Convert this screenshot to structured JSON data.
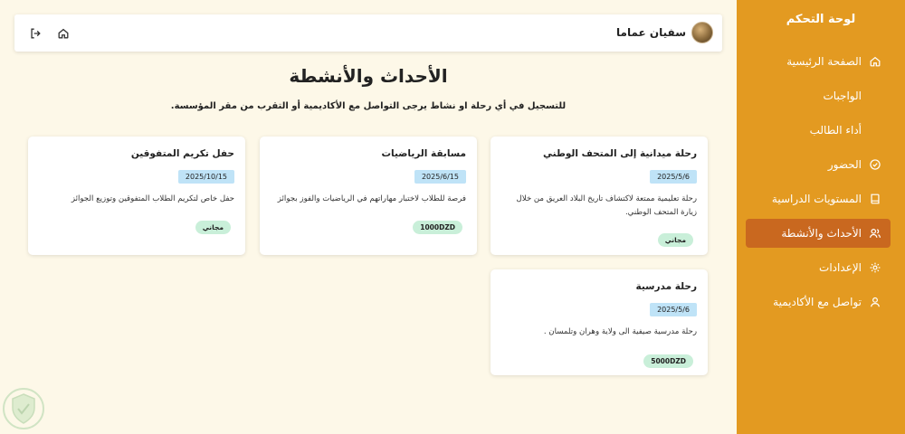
{
  "sidebar": {
    "title": "لوحة التحكم",
    "items": [
      {
        "label": "الصفحة الرئيسية",
        "icon": "home-icon"
      },
      {
        "label": "الواجبات",
        "icon": "assignment-icon"
      },
      {
        "label": "أداء الطالب",
        "icon": "chart-icon"
      },
      {
        "label": "الحضور",
        "icon": "check-circle-icon"
      },
      {
        "label": "المستويات الدراسية",
        "icon": "book-icon"
      },
      {
        "label": "الأحداث والأنشطة",
        "icon": "users-icon",
        "active": true
      },
      {
        "label": "الإعدادات",
        "icon": "gear-icon"
      },
      {
        "label": "تواصل مع الأكاديمية",
        "icon": "user-icon"
      }
    ]
  },
  "topbar": {
    "user_name": "سفيان عماما",
    "icons": [
      "logout-icon",
      "home-icon"
    ]
  },
  "page": {
    "title": "الأحداث والأنشطة",
    "subtitle": "للتسجيل في أي رحلة او نشاط يرجى التواصل مع الأكاديمية أو التقرب من مقر المؤسسة."
  },
  "events": [
    {
      "title": "رحلة ميدانية إلى المتحف الوطني",
      "date": "2025/5/6",
      "description": [
        "رحلة تعليمية ممتعة لاكتشاف تاريخ البلاد العريق من خلال",
        "زيارة المتحف الوطني."
      ],
      "price": "مجاني"
    },
    {
      "title": "مسابقة الرياضيات",
      "date": "2025/6/15",
      "description": [
        "فرصة للطلاب لاختبار مهاراتهم في الرياضيات والفوز بجوائز"
      ],
      "price": "1000DZD"
    },
    {
      "title": "حفل تكريم المتفوقين",
      "date": "2025/10/15",
      "description": [
        "حفل خاص لتكريم الطلاب المتفوقين وتوزيع الجوائز"
      ],
      "price": "مجاني"
    },
    {
      "title": "رحلة مدرسية",
      "date": "2025/5/6",
      "description": [
        "رحلة مدرسية صيفية الى ولاية وهران وتلمسان ."
      ],
      "price": "5000DZD"
    }
  ],
  "colors": {
    "sidebar_bg": "#e39a21",
    "sidebar_active": "#c9681f",
    "page_bg": "#fdf8e8",
    "date_badge": "#bfe3f7",
    "price_badge": "#c9efd9"
  }
}
